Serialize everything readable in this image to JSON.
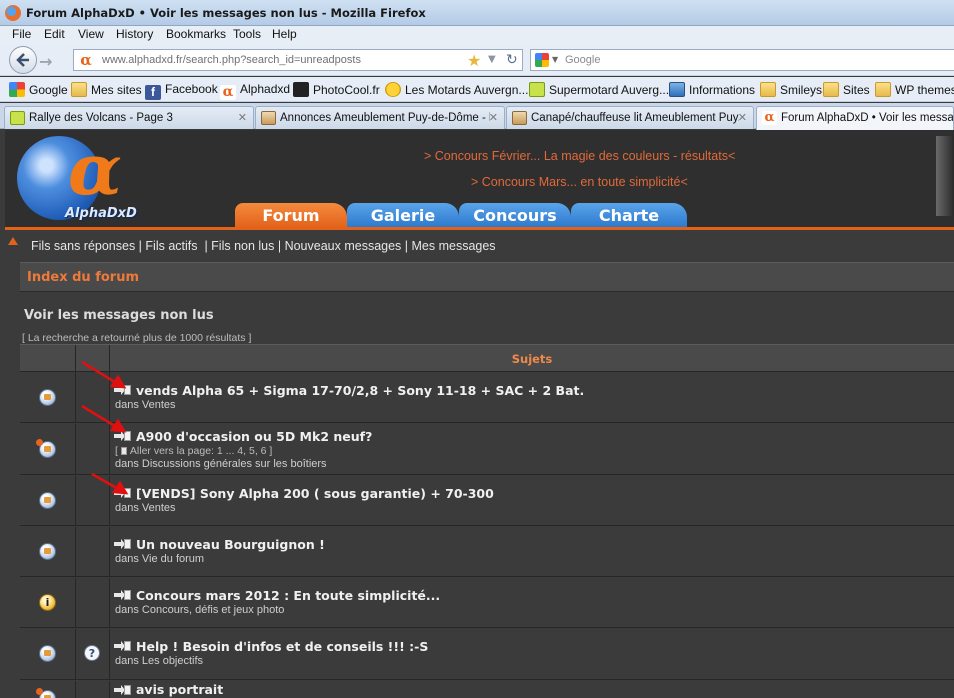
{
  "window": {
    "title": "Forum AlphaDxD • Voir les messages non lus - Mozilla Firefox"
  },
  "menu": [
    "File",
    "Edit",
    "View",
    "History",
    "Bookmarks",
    "Tools",
    "Help"
  ],
  "urlbar": {
    "url": "www.alphadxd.fr/search.php?search_id=unreadposts"
  },
  "searchbar": {
    "placeholder": "Google"
  },
  "bookmarks": [
    {
      "label": "Google",
      "icon": "google-icon"
    },
    {
      "label": "Mes sites",
      "icon": "folder-icon"
    },
    {
      "label": "Facebook",
      "icon": "facebook-icon"
    },
    {
      "label": "Alphadxd",
      "icon": "alpha-icon"
    },
    {
      "label": "PhotoCool.fr",
      "icon": "photo-icon"
    },
    {
      "label": "Les Motards Auvergn...",
      "icon": "smiley-icon"
    },
    {
      "label": "Supermotard Auverg...",
      "icon": "speech-icon"
    },
    {
      "label": "Informations",
      "icon": "monitor-icon"
    },
    {
      "label": "Smileys",
      "icon": "folder-icon"
    },
    {
      "label": "Sites",
      "icon": "folder-icon"
    },
    {
      "label": "WP themes",
      "icon": "folder-icon"
    }
  ],
  "tabs": [
    {
      "label": "Rallye des Volcans - Page 3",
      "active": false
    },
    {
      "label": "Annonces Ameublement Puy-de-Dôme - l...",
      "active": false
    },
    {
      "label": "Canapé/chauffeuse lit Ameublement Puy...",
      "active": false
    },
    {
      "label": "Forum AlphaDxD • Voir les messages",
      "active": true
    }
  ],
  "site": {
    "logo_text": "AlphaDxD",
    "logo_glyph": "α",
    "promo1": "> Concours Février... La magie des couleurs - résultats<",
    "promo2": "> Concours Mars... en toute simplicité<",
    "nav": [
      "Forum",
      "Galerie",
      "Concours",
      "Charte"
    ],
    "links": "Fils sans réponses | Fils actifs  | Fils non lus | Nouveaux messages | Mes messages",
    "breadcrumb": "Index du forum",
    "section_title": "Voir les messages non lus",
    "result_count": "[ La recherche a retourné plus de 1000 résultats ]",
    "column_header": "Sujets"
  },
  "topics": [
    {
      "title": "vends Alpha 65 + Sigma 17-70/2,8 + Sony 11-18 + SAC + 2 Bat.",
      "forum": "dans Ventes",
      "pages": ""
    },
    {
      "title": "A900 d'occasion ou 5D Mk2 neuf?",
      "forum": "dans Discussions générales sur les boîtiers",
      "pages": "Aller vers la page: 1 ... 4, 5, 6 ]"
    },
    {
      "title": "[VENDS] Sony Alpha 200 ( sous garantie) + 70-300",
      "forum": "dans Ventes",
      "pages": ""
    },
    {
      "title": "Un nouveau Bourguignon !",
      "forum": "dans Vie du forum",
      "pages": ""
    },
    {
      "title": "Concours mars 2012 : En toute simplicité...",
      "forum": "dans Concours, défis et jeux photo",
      "pages": ""
    },
    {
      "title": "Help ! Besoin d'infos et de conseils !!! :-S",
      "forum": "dans Les objectifs",
      "pages": ""
    },
    {
      "title": "avis portrait",
      "forum": "",
      "pages": ""
    }
  ]
}
